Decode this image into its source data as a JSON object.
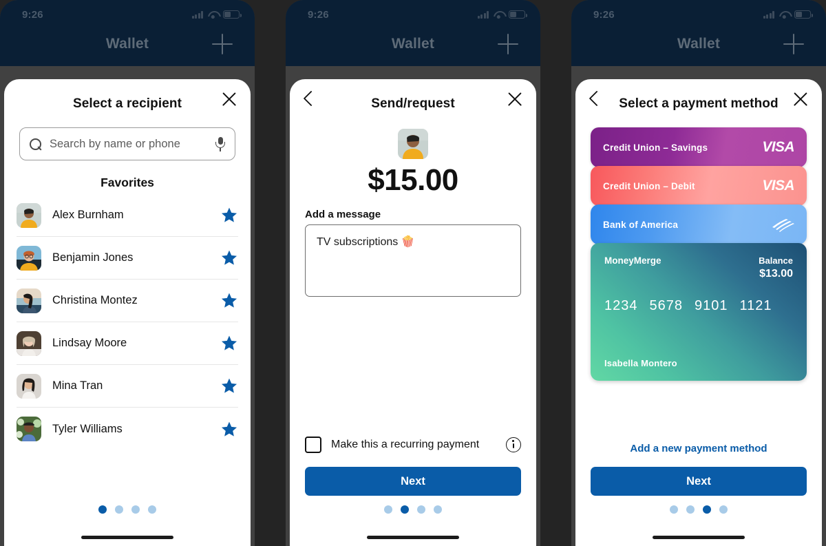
{
  "status_bar": {
    "time": "9:26",
    "signal_icon": "cellular-bars-icon",
    "wifi_icon": "wifi-icon",
    "battery_icon": "battery-icon"
  },
  "app": {
    "nav_title": "Wallet",
    "add_icon": "plus-icon"
  },
  "panel1": {
    "title": "Select a recipient",
    "close_icon": "close-icon",
    "search": {
      "placeholder": "Search by name or phone",
      "search_icon": "search-icon",
      "mic_icon": "microphone-icon"
    },
    "favorites_heading": "Favorites",
    "favorites": [
      {
        "name": "Alex Burnham",
        "starred": true
      },
      {
        "name": "Benjamin Jones",
        "starred": true
      },
      {
        "name": "Christina Montez",
        "starred": true
      },
      {
        "name": "Lindsay Moore",
        "starred": true
      },
      {
        "name": "Mina Tran",
        "starred": true
      },
      {
        "name": "Tyler Williams",
        "starred": true
      }
    ],
    "pager": {
      "count": 4,
      "active": 1
    }
  },
  "panel2": {
    "title": "Send/request",
    "back_icon": "chevron-left-icon",
    "close_icon": "close-icon",
    "recipient_avatar": "avatar",
    "amount": "$15.00",
    "message_label": "Add a message",
    "message_value": "TV subscriptions 🍿",
    "recurring_label": "Make this a recurring payment",
    "recurring_checked": false,
    "info_icon": "info-icon",
    "next_label": "Next",
    "pager": {
      "count": 4,
      "active": 2
    }
  },
  "panel3": {
    "title": "Select a payment method",
    "back_icon": "chevron-left-icon",
    "close_icon": "close-icon",
    "cards": [
      {
        "name": "Credit Union – Savings",
        "brand": "VISA"
      },
      {
        "name": "Credit Union – Debit",
        "brand": "VISA"
      },
      {
        "name": "Bank of America",
        "brand": "bank-of-america-logo"
      }
    ],
    "selected_card": {
      "brand": "MoneyMerge",
      "balance_label": "Balance",
      "balance_amount": "$13.00",
      "number_groups": [
        "1234",
        "5678",
        "9101",
        "1121"
      ],
      "holder": "Isabella Montero"
    },
    "add_method_label": "Add a new payment method",
    "next_label": "Next",
    "pager": {
      "count": 4,
      "active": 3
    }
  },
  "colors": {
    "accent_blue": "#0a5ca8",
    "pager_inactive": "#a8cbe8",
    "header_navy": "#0a1f35",
    "frame_gray": "#414141"
  }
}
